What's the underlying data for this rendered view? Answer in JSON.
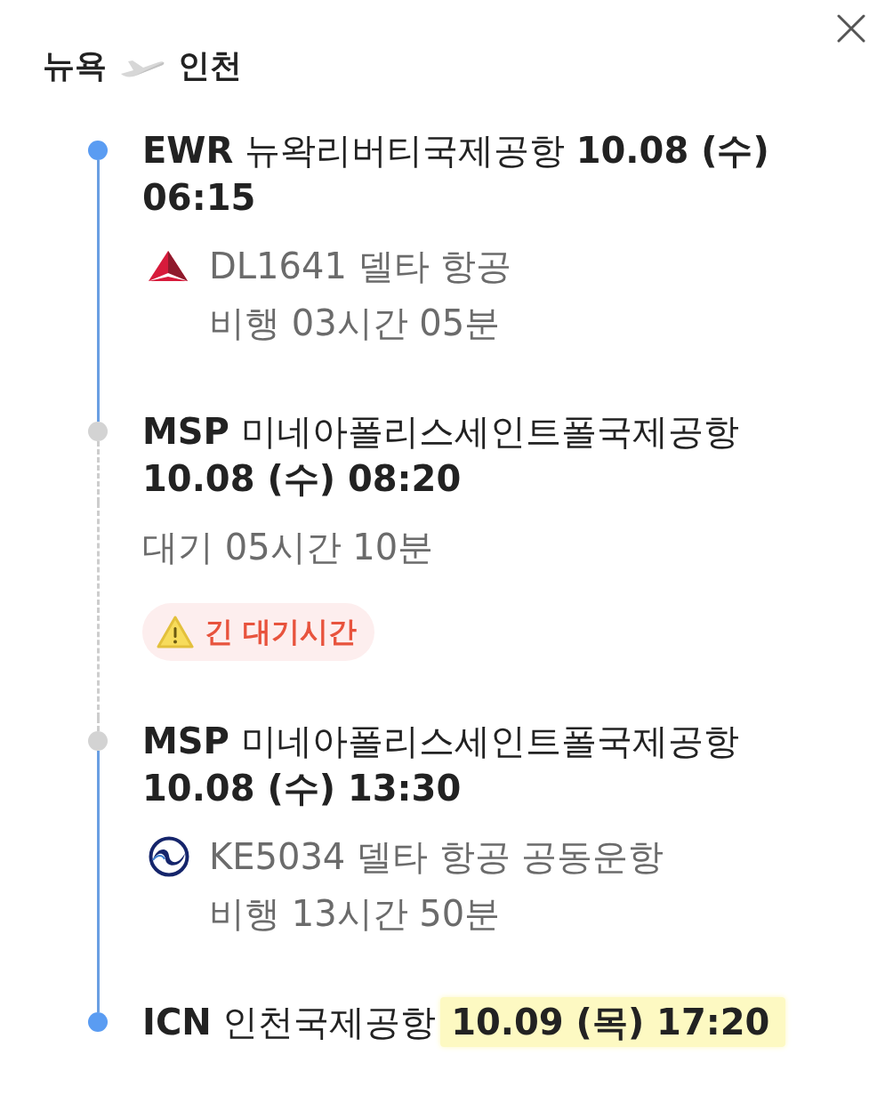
{
  "header": {
    "origin": "뉴욕",
    "destination": "인천"
  },
  "itinerary": [
    {
      "kind": "departure",
      "code": "EWR",
      "airport": "뉴왁리버티국제공항",
      "datetime": "10.08 (수) 06:15",
      "highlighted": false
    },
    {
      "kind": "flight",
      "flight": "DL1641 델타 항공",
      "duration": "비행 03시간 05분"
    },
    {
      "kind": "transfer",
      "code": "MSP",
      "airport": "미네아폴리스세인트폴국제공항",
      "datetime": "10.08 (수) 08:20",
      "highlighted": false
    },
    {
      "kind": "layover",
      "duration": "대기 05시간 10분",
      "warning": "긴 대기시간"
    },
    {
      "kind": "transfer",
      "code": "MSP",
      "airport": "미네아폴리스세인트폴국제공항",
      "datetime": "10.08 (수) 13:30",
      "highlighted": false
    },
    {
      "kind": "flight",
      "flight": "KE5034 델타 항공 공동운항",
      "duration": "비행 13시간 50분"
    },
    {
      "kind": "arrival",
      "code": "ICN",
      "airport": "인천국제공항",
      "datetime": "10.09 (목) 17:20",
      "highlighted": true
    }
  ]
}
